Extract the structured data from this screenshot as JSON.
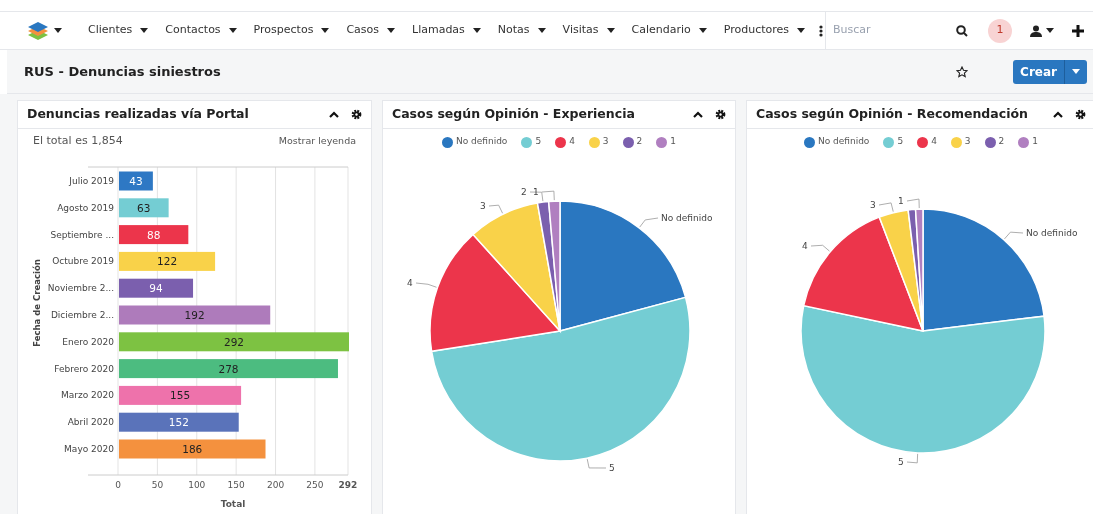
{
  "nav": {
    "items": [
      {
        "label": "Clientes"
      },
      {
        "label": "Contactos"
      },
      {
        "label": "Prospectos"
      },
      {
        "label": "Casos"
      },
      {
        "label": "Llamadas"
      },
      {
        "label": "Notas"
      },
      {
        "label": "Visitas"
      },
      {
        "label": "Calendario"
      },
      {
        "label": "Productores"
      }
    ],
    "search": {
      "placeholder": "Buscar"
    },
    "notification_count": "1"
  },
  "page_header": {
    "title": "RUS - Denuncias siniestros",
    "create_button": "Crear"
  },
  "dashlets": [
    {
      "kind": "bar",
      "title": "Denuncias realizadas vía Portal",
      "total": "El total es 1,854",
      "legend_toggle": "Mostrar leyenda",
      "bars": [
        {
          "color": "#2e78c4"
        },
        {
          "color": "#74cdd3"
        },
        {
          "color": "#ec354b"
        },
        {
          "color": "#f9d249"
        },
        {
          "color": "#7b5fae"
        },
        {
          "color": "#ae7bbb"
        },
        {
          "color": "#7dc242"
        },
        {
          "color": "#4cbc80"
        },
        {
          "color": "#ee72ab"
        },
        {
          "color": "#5a73ba"
        },
        {
          "color": "#f4913e"
        }
      ],
      "chart_data": {
        "type": "bar",
        "orientation": "horizontal",
        "xlabel": "Total",
        "ylabel": "Fecha de Creación",
        "categories": [
          "Julio 2019",
          "Agosto 2019",
          "Septiembre ...",
          "Octubre 2019",
          "Noviembre 2...",
          "Diciembre 2...",
          "Enero 2020",
          "Febrero 2020",
          "Marzo 2020",
          "Abril 2020",
          "Mayo 2020"
        ],
        "series": [
          {
            "values": [
              43,
              63,
              88,
              122,
              94,
              192,
              292,
              278,
              155,
              152,
              186
            ]
          }
        ],
        "xlim": [
          0,
          292
        ],
        "xticks": [
          0,
          50,
          100,
          150,
          200,
          250,
          292
        ],
        "grid": true,
        "data_labels": true
      }
    },
    {
      "kind": "pie",
      "title": "Casos según Opinión - Experiencia",
      "legend": [
        {
          "label": "No definido",
          "color": "#2a77c0",
          "slice_label": "No definido"
        },
        {
          "label": "5",
          "color": "#74cdd3",
          "slice_label": "5"
        },
        {
          "label": "4",
          "color": "#ec354b",
          "slice_label": "4"
        },
        {
          "label": "3",
          "color": "#f9d249",
          "slice_label": "3"
        },
        {
          "label": "2",
          "color": "#7b5fae",
          "slice_label": "2"
        },
        {
          "label": "1",
          "color": "#b07fc0",
          "slice_label": "1"
        }
      ]
    },
    {
      "kind": "pie",
      "title": "Casos según Opinión - Recomendación",
      "legend": [
        {
          "label": "No definido",
          "color": "#2a77c0",
          "slice_label": "No definido"
        },
        {
          "label": "5",
          "color": "#74cdd3",
          "slice_label": "5"
        },
        {
          "label": "4",
          "color": "#ec354b",
          "slice_label": "4"
        },
        {
          "label": "3",
          "color": "#f9d249",
          "slice_label": "3"
        },
        {
          "label": "2",
          "color": "#7b5fae"
        },
        {
          "label": "1",
          "color": "#b07fc0",
          "slice_label": "1"
        }
      ]
    }
  ]
}
